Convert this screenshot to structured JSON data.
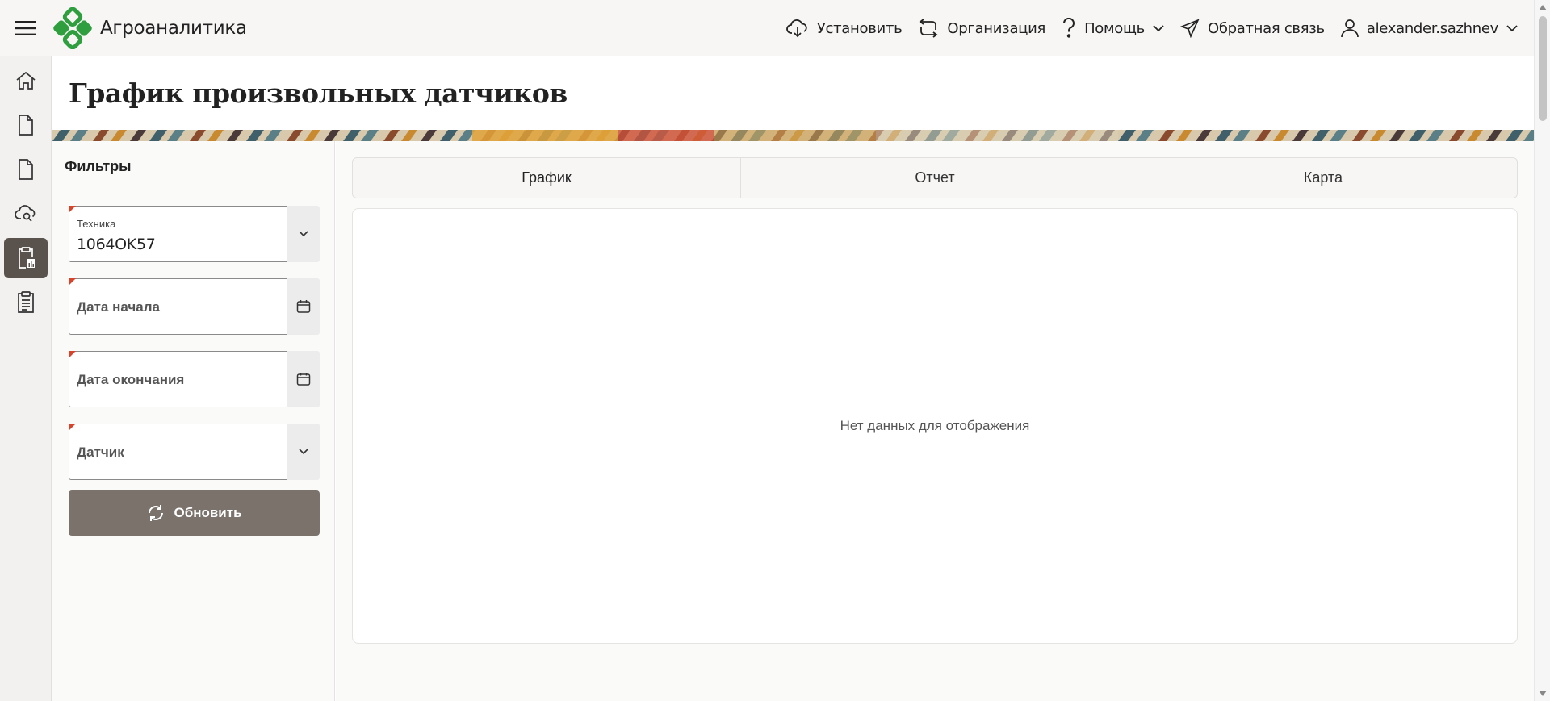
{
  "app": {
    "title": "Агроаналитика"
  },
  "topbar": {
    "install": "Установить",
    "organization": "Организация",
    "help": "Помощь",
    "feedback": "Обратная связь",
    "user": "alexander.sazhnev"
  },
  "sidebar": {
    "items": [
      {
        "icon": "home-icon",
        "active": false
      },
      {
        "icon": "document-icon",
        "active": false
      },
      {
        "icon": "document-icon",
        "active": false
      },
      {
        "icon": "cloud-search-icon",
        "active": false
      },
      {
        "icon": "clipboard-chart-icon",
        "active": true
      },
      {
        "icon": "clipboard-list-icon",
        "active": false
      }
    ]
  },
  "page": {
    "title": "График произвольных датчиков"
  },
  "filters": {
    "title": "Фильтры",
    "vehicle": {
      "label": "Техника",
      "value": "1064OK57"
    },
    "start_date": {
      "placeholder": "Дата начала"
    },
    "end_date": {
      "placeholder": "Дата окончания"
    },
    "sensor": {
      "placeholder": "Датчик"
    },
    "refresh_label": "Обновить"
  },
  "tabs": [
    {
      "label": "График",
      "active": true
    },
    {
      "label": "Отчет",
      "active": false
    },
    {
      "label": "Карта",
      "active": false
    }
  ],
  "content": {
    "empty_message": "Нет данных для отображения"
  },
  "colors": {
    "brand_green": "#2e9e3f",
    "active_rail": "#5a534d",
    "refresh_button": "#7a726b",
    "required_marker": "#d9432b"
  }
}
